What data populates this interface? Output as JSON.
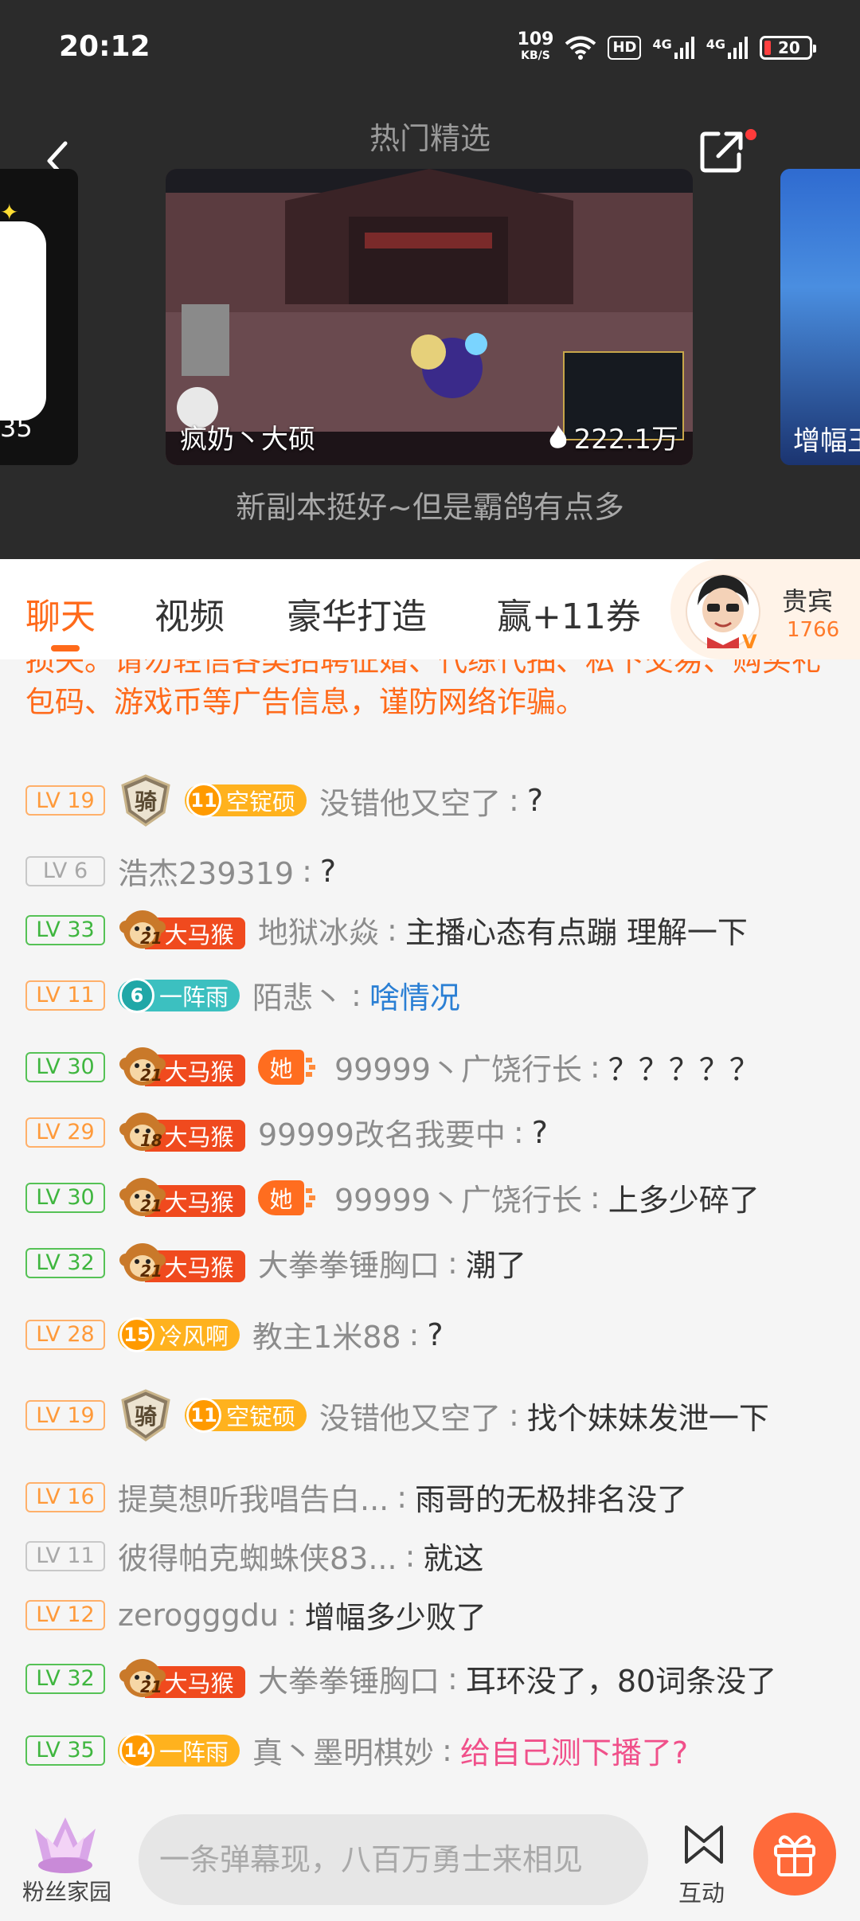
{
  "status_bar": {
    "time": "20:12",
    "net_speed": "109",
    "net_unit": "KB/S",
    "hd": "HD",
    "signal1": "4G",
    "signal2": "4G",
    "battery": "20"
  },
  "header": {
    "title": "热门精选",
    "featured": {
      "anchor": "疯奶丶大硕",
      "views": "222.1万",
      "caption": "新副本挺好~但是霸鸽有点多"
    },
    "left_card_count": "35",
    "right_card_label": "增幅王"
  },
  "tabs": [
    {
      "label": "聊天"
    },
    {
      "label": "视频"
    },
    {
      "label": "豪华打造"
    },
    {
      "label": "赢+11券"
    }
  ],
  "vip": {
    "label": "贵宾",
    "count": "1766"
  },
  "notice": "损失。请勿轻信各类招聘征婚、代练代抽、私下交易、购买礼包码、游戏币等广告信息，谨防网络诈骗。",
  "messages": [
    {
      "lv": "LV 19",
      "badge_num": "11",
      "badge_name": "空锭硕",
      "user": "没错他又空了",
      "text": "?"
    },
    {
      "lv": "LV 6",
      "user": "浩杰239319",
      "text": "?"
    },
    {
      "lv": "LV 33",
      "monkey_num": "21",
      "monkey": "大马猴",
      "user": "地狱冰焱",
      "text": "主播心态有点蹦 理解一下"
    },
    {
      "lv": "LV 11",
      "badge_num": "6",
      "badge_name": "一阵雨",
      "user": "陌悲丶",
      "text": "啥情况"
    },
    {
      "lv": "LV 30",
      "monkey_num": "21",
      "monkey": "大马猴",
      "she": "她",
      "user": "99999丶广饶行长",
      "text": "？？？？？"
    },
    {
      "lv": "LV 29",
      "monkey_num": "18",
      "monkey": "大马猴",
      "user": "99999改名我要中",
      "text": "?"
    },
    {
      "lv": "LV 30",
      "monkey_num": "21",
      "monkey": "大马猴",
      "she": "她",
      "user": "99999丶广饶行长",
      "text": "上多少碎了"
    },
    {
      "lv": "LV 32",
      "monkey_num": "21",
      "monkey": "大马猴",
      "user": "大拳拳锤胸口",
      "text": "潮了"
    },
    {
      "lv": "LV 28",
      "badge_num": "15",
      "badge_name": "冷风啊",
      "user": "教主1米88",
      "text": "?"
    },
    {
      "lv": "LV 19",
      "badge_num": "11",
      "badge_name": "空锭硕",
      "user": "没错他又空了",
      "text": "找个妹妹发泄一下"
    },
    {
      "lv": "LV 16",
      "user": "提莫想听我唱告白...",
      "text": "雨哥的无极排名没了"
    },
    {
      "lv": "LV 11",
      "user": "彼得帕克蜘蛛侠83...",
      "text": "就这"
    },
    {
      "lv": "LV 12",
      "user": "zerogggdu",
      "text": "增幅多少败了"
    },
    {
      "lv": "LV 32",
      "monkey_num": "21",
      "monkey": "大马猴",
      "user": "大拳拳锤胸口",
      "text": "耳环没了，80词条没了"
    },
    {
      "lv": "LV 35",
      "badge_num": "14",
      "badge_name": "一阵雨",
      "user": "真丶墨明棋妙",
      "text": "给自己测下播了?"
    }
  ],
  "bottom": {
    "fan_home": "粉丝家园",
    "input_placeholder": "一条弹幕现，八百万勇士来相见",
    "interact": "互动"
  },
  "colors": {
    "accent": "#ff6a1a",
    "dark_header": "#2b2b2b",
    "lv_green": "#3fb63f",
    "lv_orange": "#ff9a3a",
    "link_blue": "#2a7fd4",
    "pink": "#f0508a"
  }
}
